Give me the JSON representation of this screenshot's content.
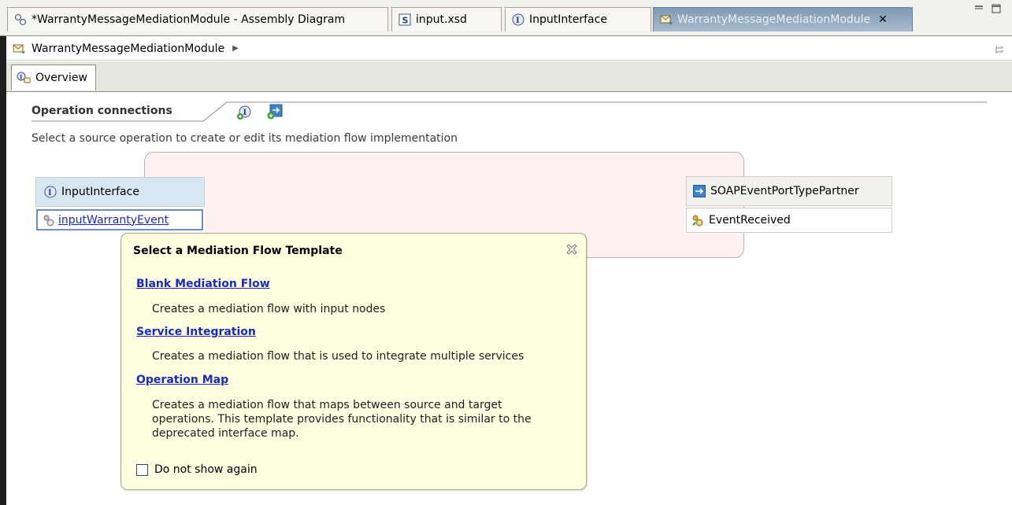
{
  "tabs": [
    {
      "label": "*WarrantyMessageMediationModule - Assembly Diagram",
      "icon": "assembly-diagram-icon"
    },
    {
      "label": "input.xsd",
      "icon": "schema-icon"
    },
    {
      "label": "InputInterface",
      "icon": "interface-icon"
    },
    {
      "label": "WarrantyMessageMediationModule",
      "icon": "mediation-module-icon",
      "active": true,
      "close": "✕"
    }
  ],
  "breadcrumb": {
    "label": "WarrantyMessageMediationModule",
    "arrow": "▶"
  },
  "editor_tab": {
    "label": "Overview"
  },
  "section": {
    "title": "Operation connections",
    "description": "Select a source operation to create or edit its mediation flow implementation"
  },
  "source_interface": {
    "name": "InputInterface",
    "operation": "inputWarrantyEvent"
  },
  "target_reference": {
    "name": "SOAPEventPortTypePartner",
    "operation": "EventReceived"
  },
  "popup": {
    "title": "Select a Mediation Flow Template",
    "templates": [
      {
        "name": "Blank Mediation Flow",
        "description": "Creates a mediation flow with input nodes"
      },
      {
        "name": "Service Integration",
        "description": "Creates a mediation flow that is used to integrate multiple services"
      },
      {
        "name": "Operation Map",
        "description": "Creates a mediation flow that maps between source and target operations. This template provides functionality that is similar to the deprecated interface map."
      }
    ],
    "checkbox_label": "Do not show again",
    "checkbox_checked": false
  },
  "colors": {
    "active_tab": "#7f9ab5",
    "link": "#1a2bb8",
    "popup_bg": "#ffffe1",
    "flow_area": "#fdf1f1",
    "interface_header": "#d8e6f1"
  }
}
